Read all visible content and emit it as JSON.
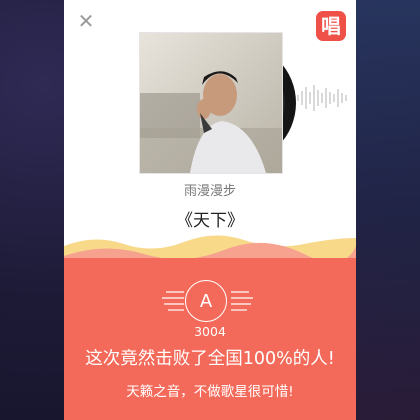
{
  "header": {
    "close_icon": "close-icon",
    "app_icon_char": "唱"
  },
  "song": {
    "artist": "雨漫漫步",
    "title": "《天下》"
  },
  "result": {
    "grade": "A",
    "score": "3004",
    "beat_text": "这次竟然击败了全国100%的人!",
    "comment": "天籁之音，不做歌星很可惜!"
  },
  "colors": {
    "accent": "#f36a5a",
    "app_badge": "#ef5148",
    "wave_yellow": "#f8d98a",
    "wave_pink": "#f6a28f"
  }
}
